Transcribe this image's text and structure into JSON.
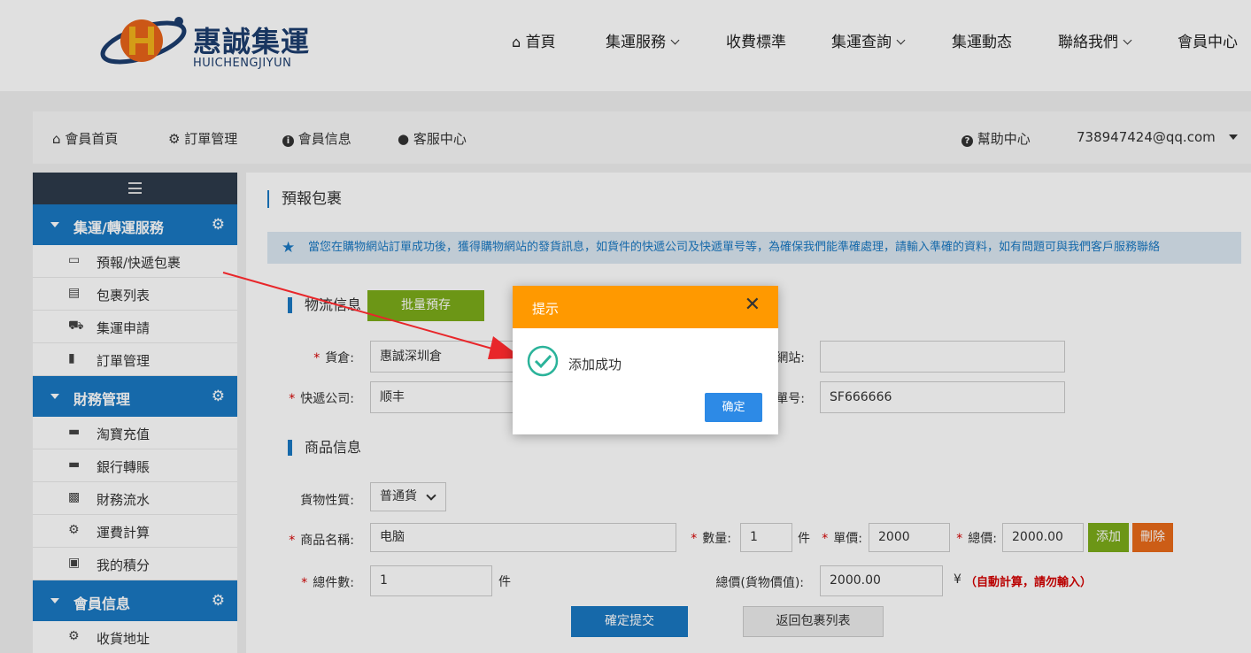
{
  "brand": {
    "name": "惠誠集運",
    "subtitle": "HUICHENGJIYUN"
  },
  "topnav": {
    "items": [
      {
        "label": "首頁",
        "icon": "home-icon"
      },
      {
        "label": "集運服務",
        "dropdown": true
      },
      {
        "label": "收費標準"
      },
      {
        "label": "集運查詢",
        "dropdown": true
      },
      {
        "label": "集運動态"
      },
      {
        "label": "聯絡我們",
        "dropdown": true
      },
      {
        "label": "會員中心"
      }
    ]
  },
  "memnav": {
    "items": [
      {
        "label": "會員首頁",
        "icon": "home-icon"
      },
      {
        "label": "訂單管理",
        "icon": "gear-icon"
      },
      {
        "label": "會員信息",
        "icon": "info-icon"
      },
      {
        "label": "客服中心",
        "icon": "user-icon"
      }
    ],
    "help": "幫助中心",
    "account": "738947424@qq.com"
  },
  "sidebar": {
    "groups": [
      {
        "title": "集運/轉運服務",
        "items": [
          {
            "label": "預報/快遞包裹",
            "icon": "hdd-icon"
          },
          {
            "label": "包裹列表",
            "icon": "list-icon"
          },
          {
            "label": "集運申請",
            "icon": "truck-icon"
          },
          {
            "label": "訂單管理",
            "icon": "book-icon"
          }
        ]
      },
      {
        "title": "財務管理",
        "items": [
          {
            "label": "淘寶充值",
            "icon": "card-icon"
          },
          {
            "label": "銀行轉賬",
            "icon": "card-icon"
          },
          {
            "label": "財務流水",
            "icon": "chart-icon"
          },
          {
            "label": "運費計算",
            "icon": "gears-icon"
          },
          {
            "label": "我的積分",
            "icon": "gift-icon"
          }
        ]
      },
      {
        "title": "會員信息",
        "items": [
          {
            "label": "收貨地址",
            "icon": "gears-icon"
          }
        ]
      }
    ]
  },
  "main": {
    "title": "預報包裹",
    "notice": "當您在購物網站訂單成功後，獲得購物網站的發貨訊息，如貨件的快遞公司及快遞單号等，為確保我們能準確處理，請輸入準確的資料，如有問題可與我們客戶服務聯絡",
    "logistics": {
      "section": "物流信息",
      "batch_button": "批量預存",
      "warehouse_label": "貨倉:",
      "warehouse_value": "惠誠深圳倉",
      "site_label_tail": "網站:",
      "site_value": "",
      "courier_label": "快遞公司:",
      "courier_value": "顺丰",
      "tracking_label_tail": "單号:",
      "tracking_value": "SF666666"
    },
    "goods": {
      "section": "商品信息",
      "type_label": "貨物性質:",
      "type_value": "普通貨",
      "name_label": "商品名稱:",
      "name_value": "电脑",
      "qty_label": "數量:",
      "qty_value": "1",
      "qty_unit": "件",
      "price_label": "單價:",
      "price_value": "2000",
      "total_label": "總價:",
      "total_value": "2000.00",
      "add_button": "添加",
      "delete_button": "刪除",
      "count_label": "總件數:",
      "count_value": "1",
      "count_unit": "件",
      "sum_label": "總價(貨物價值):",
      "sum_value": "2000.00",
      "currency": "¥",
      "auto_note": "（自動計算，請勿輸入）",
      "submit_button": "確定提交",
      "back_button": "返回包裹列表"
    }
  },
  "modal": {
    "title": "提示",
    "message": "添加成功",
    "ok_button": "确定"
  },
  "colors": {
    "primary": "#1a78c2",
    "modal_header": "#ff9900",
    "green": "#7cab1a",
    "orange": "#e96a1a",
    "ok": "#2d8ae6"
  }
}
